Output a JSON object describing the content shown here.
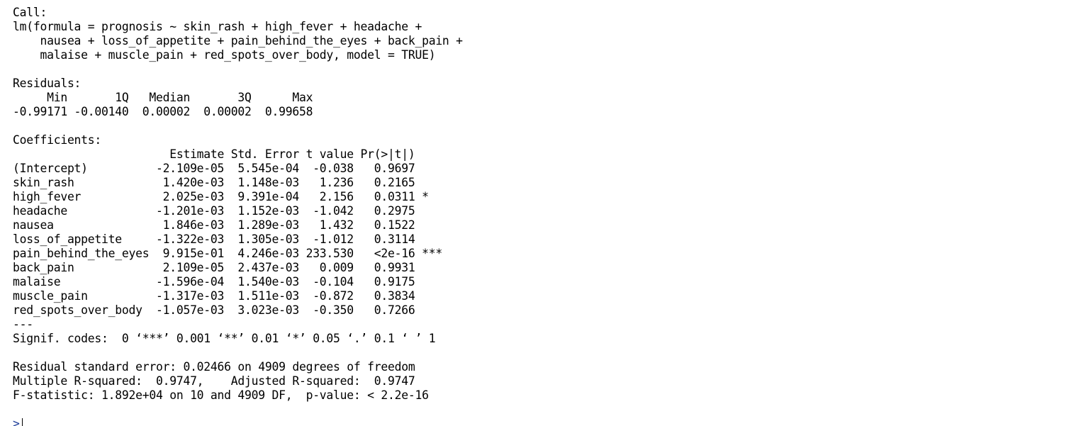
{
  "console": {
    "lines": [
      "Call:",
      "lm(formula = prognosis ~ skin_rash + high_fever + headache +",
      "    nausea + loss_of_appetite + pain_behind_the_eyes + back_pain +",
      "    malaise + muscle_pain + red_spots_over_body, model = TRUE)",
      "",
      "Residuals:",
      "     Min       1Q   Median       3Q      Max",
      "-0.99171 -0.00140  0.00002  0.00002  0.99658",
      "",
      "Coefficients:",
      "                       Estimate Std. Error t value Pr(>|t|)",
      "(Intercept)          -2.109e-05  5.545e-04  -0.038   0.9697",
      "skin_rash             1.420e-03  1.148e-03   1.236   0.2165",
      "high_fever            2.025e-03  9.391e-04   2.156   0.0311 *",
      "headache             -1.201e-03  1.152e-03  -1.042   0.2975",
      "nausea                1.846e-03  1.289e-03   1.432   0.1522",
      "loss_of_appetite     -1.322e-03  1.305e-03  -1.012   0.3114",
      "pain_behind_the_eyes  9.915e-01  4.246e-03 233.530   <2e-16 ***",
      "back_pain             2.109e-05  2.437e-03   0.009   0.9931",
      "malaise              -1.596e-04  1.540e-03  -0.104   0.9175",
      "muscle_pain          -1.317e-03  1.511e-03  -0.872   0.3834",
      "red_spots_over_body  -1.057e-03  3.023e-03  -0.350   0.7266",
      "---",
      "Signif. codes:  0 ‘***’ 0.001 ‘**’ 0.01 ‘*’ 0.05 ‘.’ 0.1 ‘ ’ 1",
      "",
      "Residual standard error: 0.02466 on 4909 degrees of freedom",
      "Multiple R-squared:  0.9747,    Adjusted R-squared:  0.9747",
      "F-statistic: 1.892e+04 on 10 and 4909 DF,  p-value: < 2.2e-16"
    ],
    "prompt": ">"
  }
}
